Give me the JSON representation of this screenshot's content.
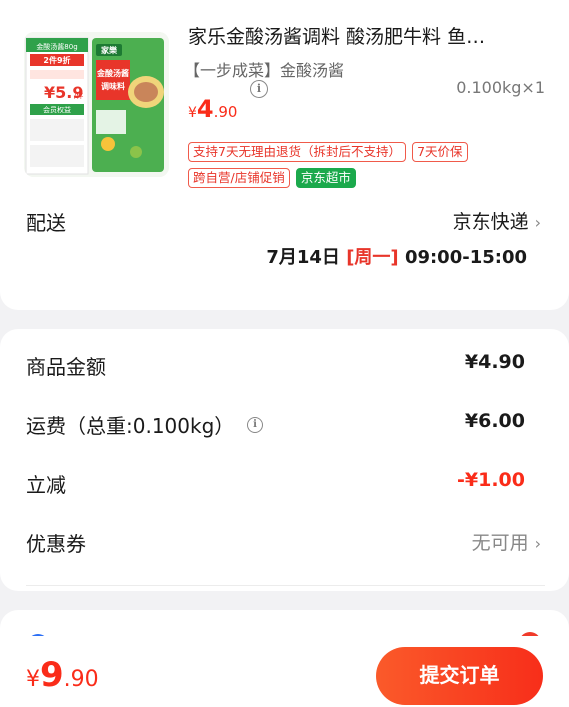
{
  "product": {
    "title": "家乐金酸汤酱调料 酸汤肥牛料 鱼…",
    "spec": "【一步成菜】金酸汤酱",
    "price_yen": "¥",
    "price_int": "4",
    "price_dec": ".90",
    "quantity": "0.100kg×1",
    "tags": [
      "支持7天无理由退货（拆封后不支持）",
      "7天价保",
      "跨自营/店铺促销",
      "京东超市"
    ],
    "image": {
      "brand": "家樂",
      "name_line1": "金酸汤酱",
      "name_line2": "调味料",
      "banner1": "金酸汤酱80g",
      "banner2": "2件9折",
      "price": "¥5.9",
      "price_unit": "/件",
      "member": "会员权益"
    }
  },
  "shipping": {
    "label": "配送",
    "method": "京东快递",
    "date": "7月14日",
    "weekday": "[周一]",
    "time": "09:00-15:00"
  },
  "summary": {
    "goods_label": "商品金额",
    "goods_value": "¥4.90",
    "freight_label": "运费（总重:0.100kg）",
    "freight_value": "¥6.00",
    "discount_label": "立减",
    "discount_value": "-¥1.00",
    "coupon_label": "优惠券",
    "coupon_value": "无可用"
  },
  "footer": {
    "total_yen": "¥",
    "total_int": "9",
    "total_dec": ".90",
    "submit_label": "提交订单"
  },
  "colors": {
    "accent": "#fa2c19",
    "green_tag": "#1ba94c",
    "blue_dot": "#2a6ef5"
  }
}
